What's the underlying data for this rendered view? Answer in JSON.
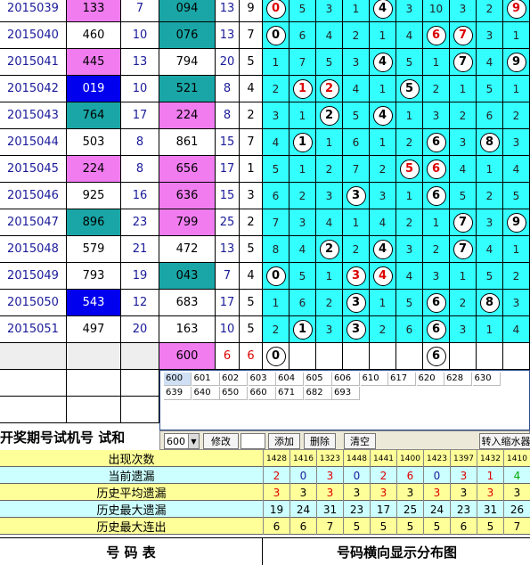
{
  "rows": [
    {
      "period": "2015039",
      "n1": "133",
      "s1": "7",
      "n2": "094",
      "s2": "13",
      "d": "9",
      "c1": "#f07cf0",
      "c2": "#1aa6a6",
      "dist": {
        "0": "r",
        "1": "5",
        "2": "3",
        "3": "1",
        "4": "b",
        "5": "3",
        "6": "10",
        "7": "3",
        "8": "2",
        "9": "r"
      }
    },
    {
      "period": "2015040",
      "n1": "460",
      "s1": "10",
      "n2": "076",
      "s2": "13",
      "d": "7",
      "c1": "#fff",
      "c2": "#1aa6a6",
      "dist": {
        "0": "b",
        "1": "6",
        "2": "4",
        "3": "2",
        "4": "1",
        "5": "4",
        "6": "r",
        "7": "r",
        "8": "3",
        "9": "1"
      }
    },
    {
      "period": "2015041",
      "n1": "445",
      "s1": "13",
      "n2": "794",
      "s2": "20",
      "d": "5",
      "c1": "#f07cf0",
      "c2": "#fff",
      "dist": {
        "0": "1",
        "1": "7",
        "2": "5",
        "3": "3",
        "4": "b",
        "5": "5",
        "6": "1",
        "7": "b",
        "8": "4",
        "9": "b"
      }
    },
    {
      "period": "2015042",
      "n1": "019",
      "s1": "10",
      "n2": "521",
      "s2": "8",
      "d": "4",
      "c1": "#0000ee",
      "c2": "#1aa6a6",
      "dist": {
        "0": "2",
        "1": "r",
        "2": "r",
        "3": "4",
        "4": "1",
        "5": "b",
        "6": "2",
        "7": "1",
        "8": "5",
        "9": "1"
      }
    },
    {
      "period": "2015043",
      "n1": "764",
      "s1": "17",
      "n2": "224",
      "s2": "8",
      "d": "2",
      "c1": "#1aa6a6",
      "c2": "#f07cf0",
      "dist": {
        "0": "3",
        "1": "1",
        "2": "b",
        "3": "5",
        "4": "b",
        "5": "1",
        "6": "3",
        "7": "2",
        "8": "6",
        "9": "2"
      }
    },
    {
      "period": "2015044",
      "n1": "503",
      "s1": "8",
      "n2": "861",
      "s2": "15",
      "d": "7",
      "c1": "#fff",
      "c2": "#fff",
      "dist": {
        "0": "4",
        "1": "b",
        "2": "1",
        "3": "6",
        "4": "1",
        "5": "2",
        "6": "b",
        "7": "3",
        "8": "b",
        "9": "3"
      }
    },
    {
      "period": "2015045",
      "n1": "224",
      "s1": "8",
      "n2": "656",
      "s2": "17",
      "d": "1",
      "c1": "#f07cf0",
      "c2": "#f07cf0",
      "dist": {
        "0": "5",
        "1": "1",
        "2": "2",
        "3": "7",
        "4": "2",
        "5": "r",
        "6": "r",
        "7": "4",
        "8": "1",
        "9": "4"
      }
    },
    {
      "period": "2015046",
      "n1": "925",
      "s1": "16",
      "n2": "636",
      "s2": "15",
      "d": "3",
      "c1": "#fff",
      "c2": "#f07cf0",
      "dist": {
        "0": "6",
        "1": "2",
        "2": "3",
        "3": "b",
        "4": "3",
        "5": "1",
        "6": "b",
        "7": "5",
        "8": "2",
        "9": "5"
      }
    },
    {
      "period": "2015047",
      "n1": "896",
      "s1": "23",
      "n2": "799",
      "s2": "25",
      "d": "2",
      "c1": "#1aa6a6",
      "c2": "#f07cf0",
      "dist": {
        "0": "7",
        "1": "3",
        "2": "4",
        "3": "1",
        "4": "4",
        "5": "2",
        "6": "1",
        "7": "b",
        "8": "3",
        "9": "b"
      }
    },
    {
      "period": "2015048",
      "n1": "579",
      "s1": "21",
      "n2": "472",
      "s2": "13",
      "d": "5",
      "c1": "#fff",
      "c2": "#fff",
      "dist": {
        "0": "8",
        "1": "4",
        "2": "b",
        "3": "2",
        "4": "b",
        "5": "3",
        "6": "2",
        "7": "b",
        "8": "4",
        "9": "1"
      }
    },
    {
      "period": "2015049",
      "n1": "793",
      "s1": "19",
      "n2": "043",
      "s2": "7",
      "d": "4",
      "c1": "#fff",
      "c2": "#1aa6a6",
      "dist": {
        "0": "b",
        "1": "5",
        "2": "1",
        "3": "r",
        "4": "r",
        "5": "4",
        "6": "3",
        "7": "1",
        "8": "5",
        "9": "2"
      }
    },
    {
      "period": "2015050",
      "n1": "543",
      "s1": "12",
      "n2": "683",
      "s2": "17",
      "d": "5",
      "c1": "#0000ee",
      "c2": "#fff",
      "dist": {
        "0": "1",
        "1": "6",
        "2": "2",
        "3": "b",
        "4": "1",
        "5": "5",
        "6": "b",
        "7": "2",
        "8": "b",
        "9": "3"
      }
    },
    {
      "period": "2015051",
      "n1": "497",
      "s1": "20",
      "n2": "163",
      "s2": "10",
      "d": "5",
      "c1": "#fff",
      "c2": "#fff",
      "dist": {
        "0": "2",
        "1": "b",
        "2": "3",
        "3": "b",
        "4": "2",
        "5": "6",
        "6": "b",
        "7": "3",
        "8": "1",
        "9": "4"
      }
    }
  ],
  "pending": {
    "n2": "600",
    "s2": "6",
    "d": "6",
    "balls": [
      "0",
      "6"
    ]
  },
  "popup_numbers": [
    "600",
    "601",
    "602",
    "603",
    "604",
    "605",
    "606",
    "610",
    "617",
    "620",
    "628",
    "630",
    "639",
    "640",
    "650",
    "660",
    "671",
    "682",
    "693"
  ],
  "toolbar": {
    "select_value": "600",
    "modify": "修改",
    "add": "添加",
    "delete": "删除",
    "clear": "清空",
    "switch": "转入缩水器"
  },
  "header_title": "开奖期号试机号 试和",
  "stats": [
    {
      "label": "出现次数",
      "values": [
        "1428",
        "1416",
        "1323",
        "1448",
        "1441",
        "1400",
        "1423",
        "1397",
        "1432",
        "1410"
      ],
      "bg": "#ffff99",
      "small": true
    },
    {
      "label": "当前遗漏",
      "values": [
        "2",
        "0",
        "3",
        "0",
        "2",
        "6",
        "0",
        "3",
        "1",
        "4"
      ],
      "bg": "#ccffff",
      "colored": true
    },
    {
      "label": "历史平均遗漏",
      "values": [
        "3",
        "3",
        "3",
        "3",
        "3",
        "3",
        "3",
        "3",
        "3",
        "3"
      ],
      "bg": "#ffff99",
      "redAlt": true
    },
    {
      "label": "历史最大遗漏",
      "values": [
        "19",
        "24",
        "31",
        "23",
        "17",
        "25",
        "24",
        "23",
        "31",
        "26"
      ],
      "bg": "#ccffff"
    },
    {
      "label": "历史最大连出",
      "values": [
        "6",
        "6",
        "7",
        "5",
        "5",
        "5",
        "5",
        "6",
        "5",
        "7"
      ],
      "bg": "#ffff99"
    }
  ],
  "footer": {
    "left": "号    码    表",
    "right": "号码横向显示分布图"
  }
}
